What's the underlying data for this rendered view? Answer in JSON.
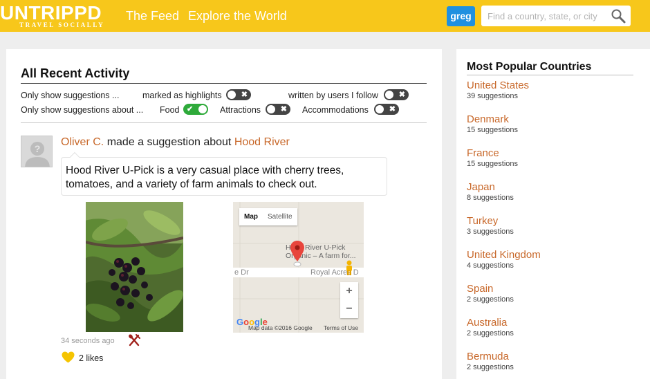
{
  "header": {
    "logo_main": "UNTRIPPD",
    "logo_sub": "TRAVEL SOCIALLY",
    "nav": [
      "The Feed",
      "Explore the World"
    ],
    "user": "greg",
    "search_placeholder": "Find a country, state, or city"
  },
  "activity": {
    "title": "All Recent Activity",
    "filters": {
      "row1_label": "Only show suggestions ...",
      "highlights_label": "marked as highlights",
      "follow_label": "written by users I follow",
      "row2_label": "Only show suggestions about ...",
      "food_label": "Food",
      "attractions_label": "Attractions",
      "accommodations_label": "Accommodations",
      "toggle_on_mark": "✔",
      "toggle_off_mark": "✖"
    },
    "toggles": {
      "highlights": false,
      "follow": false,
      "food": true,
      "attractions": false,
      "accommodations": false
    },
    "post": {
      "user": "Oliver C.",
      "action": "made a suggestion about",
      "place": "Hood River",
      "text": "Hood River U-Pick is a very casual place with cherry trees, tomatoes, and a variety of farm animals to check out.",
      "timestamp": "34 seconds ago",
      "likes": "2 likes",
      "map": {
        "tabs": [
          "Map",
          "Satellite"
        ],
        "place_label": "Hood River U-Pick Organic – A farm for...",
        "road_left": "e Dr",
        "road_right": "Royal Acres D",
        "zoom_in": "+",
        "zoom_out": "−",
        "google_logo": "Google",
        "attribution": "Map data ©2016 Google",
        "terms": "Terms of Use"
      }
    }
  },
  "sidebar": {
    "title": "Most Popular Countries",
    "countries": [
      {
        "name": "United States",
        "count": "39 suggestions"
      },
      {
        "name": "Denmark",
        "count": "15 suggestions"
      },
      {
        "name": "France",
        "count": "15 suggestions"
      },
      {
        "name": "Japan",
        "count": "8 suggestions"
      },
      {
        "name": "Turkey",
        "count": "3 suggestions"
      },
      {
        "name": "United Kingdom",
        "count": "4 suggestions"
      },
      {
        "name": "Spain",
        "count": "2 suggestions"
      },
      {
        "name": "Australia",
        "count": "2 suggestions"
      },
      {
        "name": "Bermuda",
        "count": "2 suggestions"
      }
    ]
  },
  "colors": {
    "header_bg": "#f7c71b",
    "link": "#c8682a",
    "user_button": "#1e90e0",
    "toggle_on": "#2eaa3a",
    "toggle_off": "#444444",
    "like_heart": "#f5c400",
    "food_icon": "#a0201a"
  },
  "icons": [
    "search-icon",
    "avatar-placeholder-icon",
    "map-pin-icon",
    "pegman-icon",
    "food-icon",
    "heart-icon"
  ]
}
